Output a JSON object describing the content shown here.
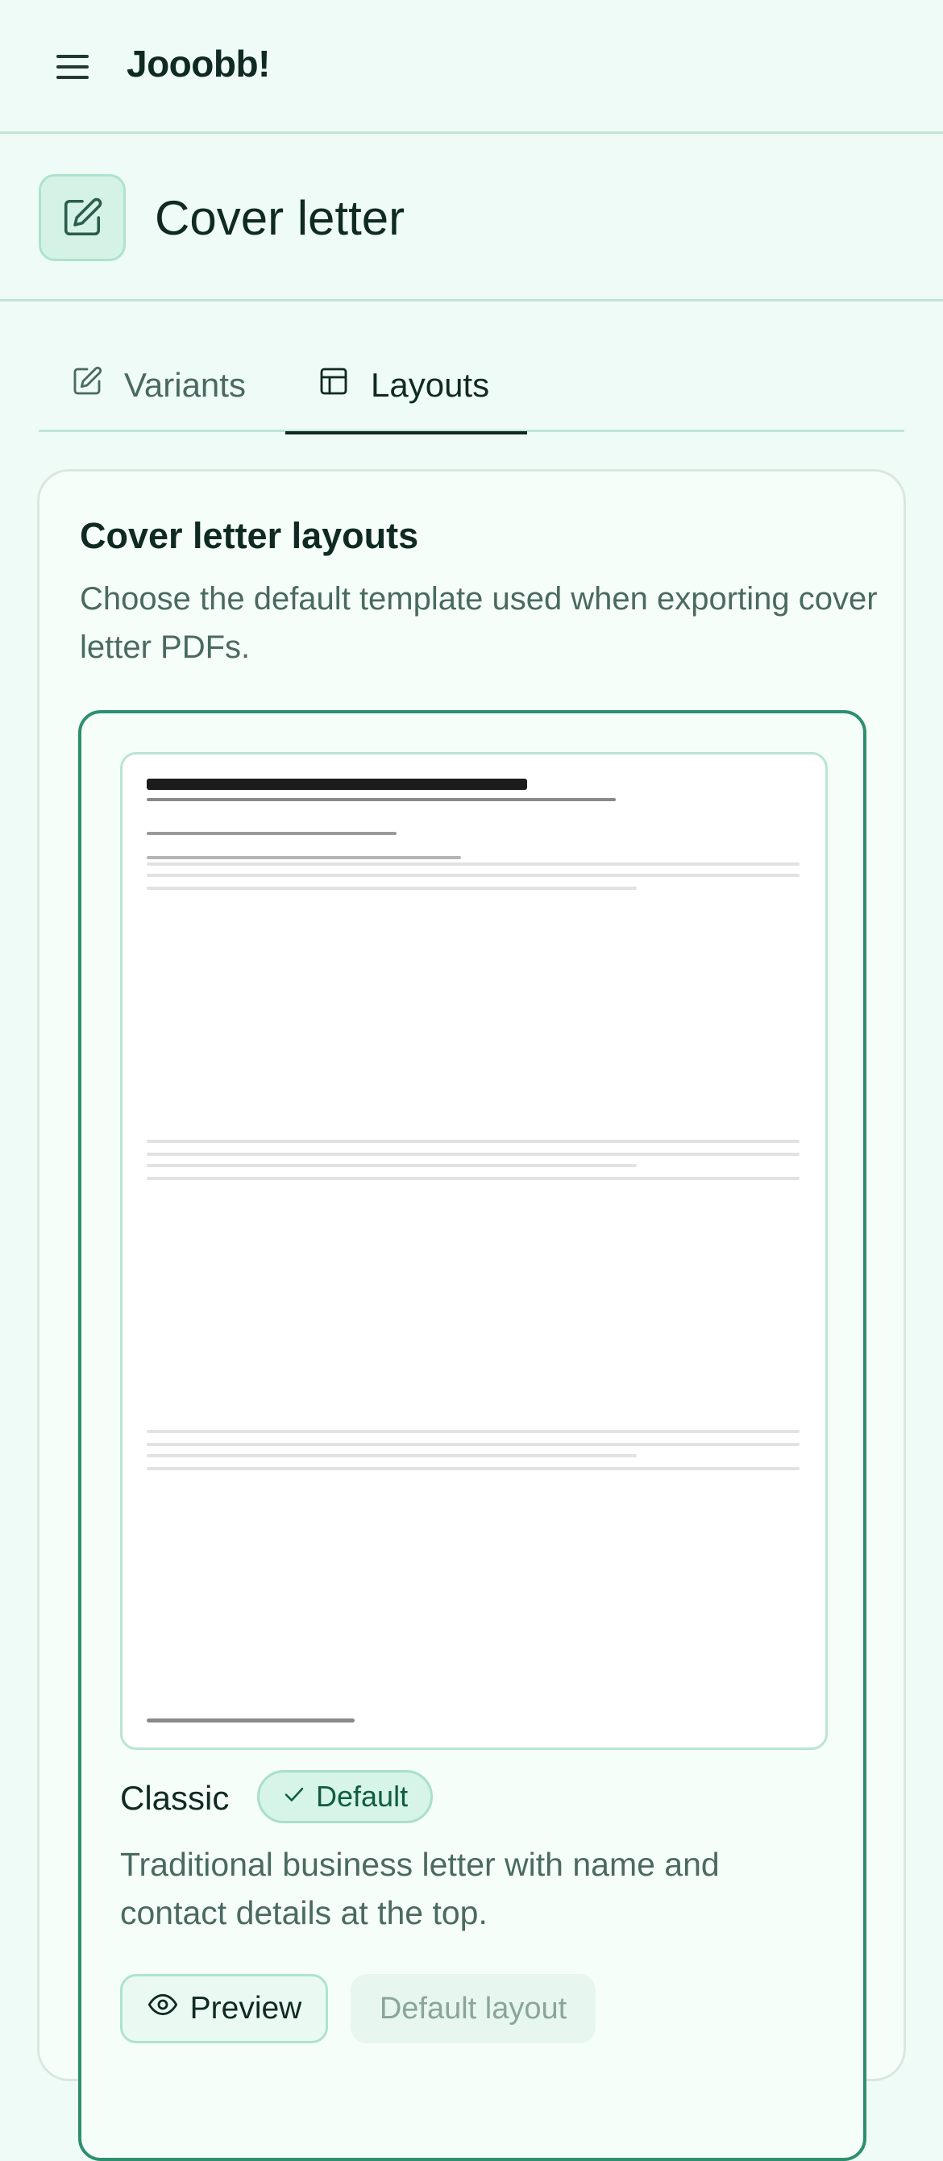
{
  "app": {
    "brand": "Jooobb!"
  },
  "icons": {
    "menu": "menu-icon",
    "edit": "edit-square-icon",
    "layout": "layout-template-icon",
    "check": "check-icon",
    "eye": "eye-icon"
  },
  "header": {
    "title": "Cover letter"
  },
  "tabs": [
    {
      "label": "Variants",
      "active": false
    },
    {
      "label": "Layouts",
      "active": true
    }
  ],
  "panel": {
    "title": "Cover letter layouts",
    "description": "Choose the default template used when exporting cover letter PDFs."
  },
  "layouts": [
    {
      "name": "Classic",
      "badge": "Default",
      "description": "Traditional business letter with name and contact details at the top.",
      "preview_label": "Preview",
      "set_default_label": "Default layout",
      "set_default_disabled": true,
      "selected": true
    }
  ],
  "colors": {
    "background": "#effbf6",
    "accent": "#2e8f70",
    "badge_bg": "#d6f4e7",
    "border": "#bfe6d5"
  }
}
